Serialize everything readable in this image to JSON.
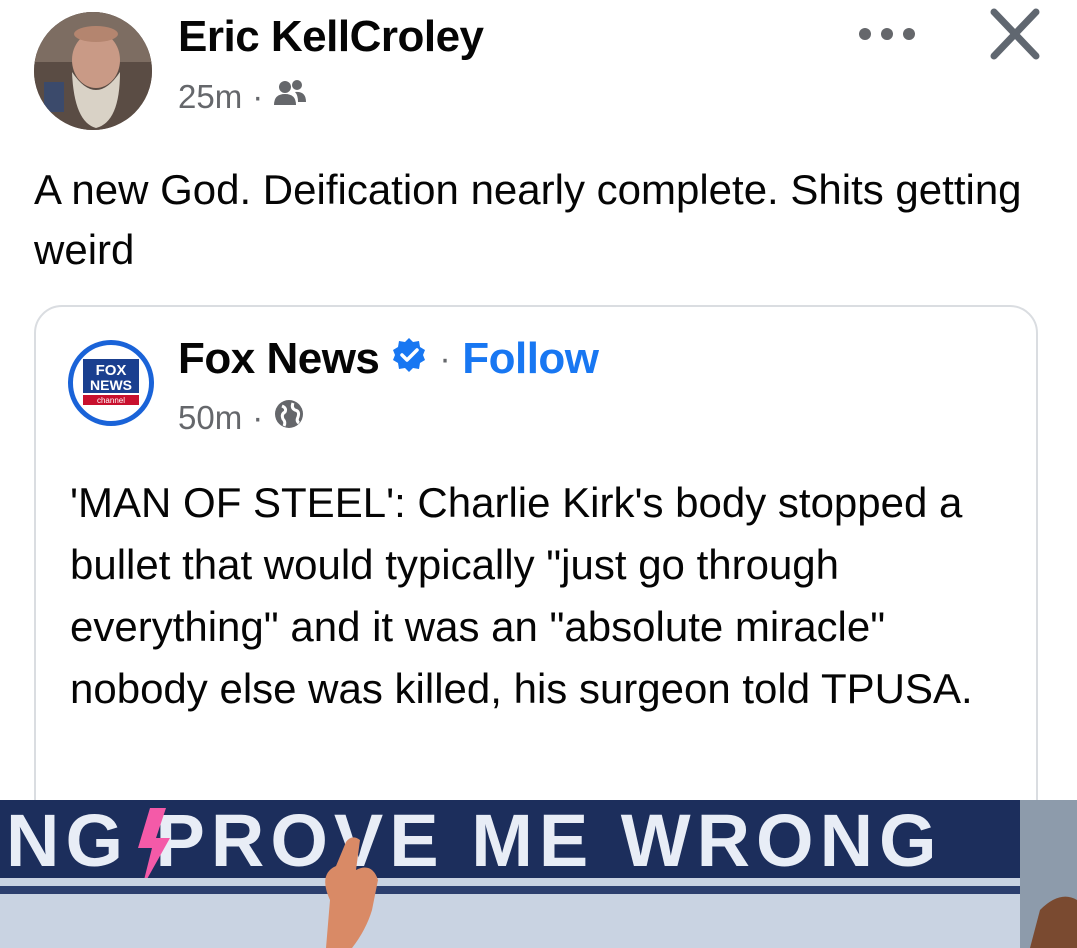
{
  "post": {
    "author": "Eric KellCroley",
    "time": "25m",
    "separator": "·",
    "audience_icon": "friends-icon",
    "text": "A new God. Deification nearly complete. Shits getting weird"
  },
  "toolbar": {
    "more_icon": "more-options-icon",
    "close_icon": "close-icon"
  },
  "shared": {
    "page_name": "Fox News",
    "verified_icon": "verified-badge-icon",
    "separator": "·",
    "follow_label": "Follow",
    "time": "50m",
    "audience_icon": "globe-icon",
    "text": "'MAN OF STEEL': Charlie Kirk's body stopped a bullet that would typically \"just go through everything\" and it was an \"absolute miracle\" nobody else was killed, his surgeon told TPUSA.",
    "logo_text": {
      "line1": "FOX",
      "line2": "NEWS",
      "line3": "channel"
    },
    "photo_banner_text": "NG PROVE ME WRONG"
  },
  "colors": {
    "link_blue": "#1877f2",
    "secondary_text": "#65676b",
    "verified_blue": "#1877f2",
    "banner_navy": "#1c2e5c"
  }
}
